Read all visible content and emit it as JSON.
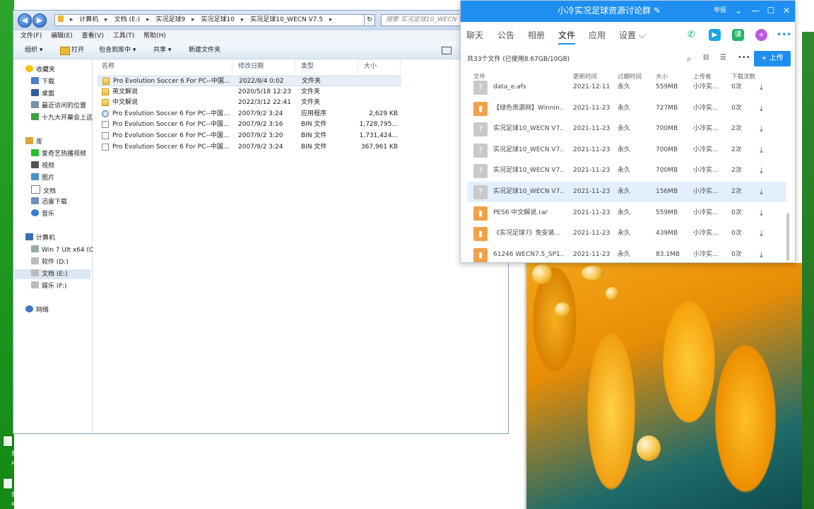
{
  "explorer": {
    "breadcrumb": [
      "计算机",
      "文档 (E:)",
      "实况足球9",
      "实况足球10",
      "实况足球10_WECN V7.5"
    ],
    "search_placeholder": "搜索 实况足球10_WECN V",
    "menu": [
      "文件(F)",
      "编辑(E)",
      "查看(V)",
      "工具(T)",
      "帮助(H)"
    ],
    "toolbar": {
      "organize": "组织 ▾",
      "open": "打开",
      "include": "包含到库中 ▾",
      "share": "共享 ▾",
      "new_folder": "新建文件夹"
    },
    "nav": {
      "favorites": "收藏夹",
      "fav_items": [
        "下载",
        "桌面",
        "最近访问的位置",
        "十九大开幕会上这"
      ],
      "libraries": "库",
      "lib_items": [
        "爱奇艺热播视频",
        "视频",
        "图片",
        "文档",
        "迅雷下载",
        "音乐"
      ],
      "computer": "计算机",
      "drives": [
        "Win 7 Ult x64 (C",
        "软件 (D:)",
        "文档 (E:)",
        "娱乐 (F:)"
      ],
      "network": "网络"
    },
    "columns": [
      "名称",
      "修改日期",
      "类型",
      "大小"
    ],
    "files": [
      {
        "name": "Pro Evolution Soccer 6 For PC--中国...",
        "date": "2022/8/4 0:02",
        "type": "文件夹",
        "size": "",
        "icon": "folder-icon"
      },
      {
        "name": "英文解说",
        "date": "2020/5/18 12:23",
        "type": "文件夹",
        "size": "",
        "icon": "folder-icon"
      },
      {
        "name": "中文解说",
        "date": "2022/3/12 22:41",
        "type": "文件夹",
        "size": "",
        "icon": "folder-icon"
      },
      {
        "name": "Pro Evolution Soccer 6 For PC--中国...",
        "date": "2007/9/2 3:24",
        "type": "应用程序",
        "size": "2,629 KB",
        "icon": "application-icon"
      },
      {
        "name": "Pro Evolution Soccer 6 For PC--中国...",
        "date": "2007/9/2 3:16",
        "type": "BIN 文件",
        "size": "1,728,795...",
        "icon": "file-icon"
      },
      {
        "name": "Pro Evolution Soccer 6 For PC--中国...",
        "date": "2007/9/2 3:20",
        "type": "BIN 文件",
        "size": "1,731,424...",
        "icon": "file-icon"
      },
      {
        "name": "Pro Evolution Soccer 6 For PC--中国...",
        "date": "2007/9/2 3:24",
        "type": "BIN 文件",
        "size": "367,961 KB",
        "icon": "file-icon"
      }
    ]
  },
  "desktop": {
    "labels": [
      "条格式",
      "x (2)",
      "条格式",
      "x"
    ]
  },
  "qq": {
    "title": "小冷实况足球资源讨论群",
    "report": "举报",
    "tabs": [
      "聊天",
      "公告",
      "相册",
      "文件",
      "应用",
      "设置 ⌵"
    ],
    "info": "共33个文件 (已使用8.67GB/10GB)",
    "upload": "+ 上传",
    "columns": [
      "文件",
      "更新时间",
      "过期时间",
      "大小",
      "上传者",
      "下载次数"
    ],
    "files": [
      {
        "name": "data_e.afs",
        "updated": "2021-12-11",
        "expire": "永久",
        "size": "559MB",
        "uploader": "小冷实...",
        "downloads": "0次",
        "icon": "unknown"
      },
      {
        "name": "【绿色资源网】Winnin...",
        "updated": "2021-11-23",
        "expire": "永久",
        "size": "727MB",
        "uploader": "小冷实...",
        "downloads": "0次",
        "icon": "archive"
      },
      {
        "name": "实况足球10_WECN V7...",
        "updated": "2021-11-23",
        "expire": "永久",
        "size": "700MB",
        "uploader": "小冷实...",
        "downloads": "2次",
        "icon": "unknown"
      },
      {
        "name": "实况足球10_WECN V7...",
        "updated": "2021-11-23",
        "expire": "永久",
        "size": "700MB",
        "uploader": "小冷实...",
        "downloads": "2次",
        "icon": "unknown"
      },
      {
        "name": "实况足球10_WECN V7...",
        "updated": "2021-11-23",
        "expire": "永久",
        "size": "700MB",
        "uploader": "小冷实...",
        "downloads": "2次",
        "icon": "unknown"
      },
      {
        "name": "实况足球10_WECN V7...",
        "updated": "2021-11-23",
        "expire": "永久",
        "size": "156MB",
        "uploader": "小冷实...",
        "downloads": "2次",
        "icon": "unknown"
      },
      {
        "name": "PES6 中文解说.rar",
        "updated": "2021-11-23",
        "expire": "永久",
        "size": "559MB",
        "uploader": "小冷实...",
        "downloads": "0次",
        "icon": "archive"
      },
      {
        "name": "《实况足球7》免安装...",
        "updated": "2021-11-23",
        "expire": "永久",
        "size": "439MB",
        "uploader": "小冷实...",
        "downloads": "0次",
        "icon": "archive"
      },
      {
        "name": "61246 WECN7.5_SP1...",
        "updated": "2021-11-23",
        "expire": "永久",
        "size": "83.1MB",
        "uploader": "小冷实...",
        "downloads": "0次",
        "icon": "archive"
      }
    ]
  },
  "colors": {
    "qq_blue": "#1e8ff0",
    "archive_orange": "#f0a24a",
    "unknown_gray": "#c9c9c9",
    "row_highlight": "#e3f0fc"
  }
}
